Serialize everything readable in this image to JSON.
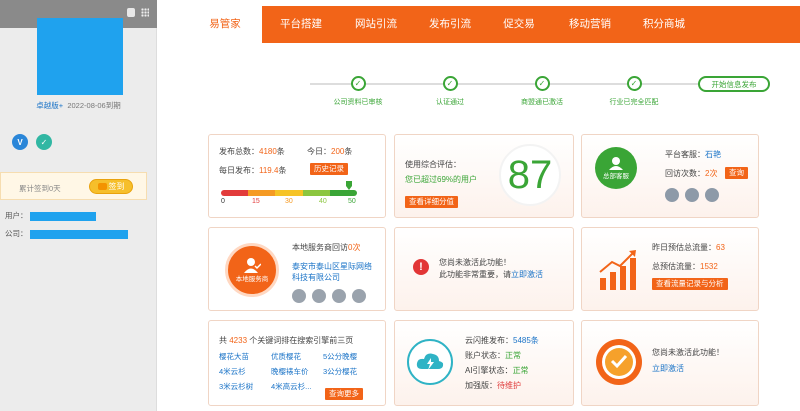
{
  "sidebar": {
    "edition": "卓越版+",
    "expire": "2022-08-06到期",
    "sign_label": "累计签到0天",
    "sign_button": "签到",
    "user_label": "用户：",
    "company_label": "公司："
  },
  "nav": {
    "tabs": [
      "易管家",
      "平台搭建",
      "网站引流",
      "发布引流",
      "促交易",
      "移动营销",
      "积分商城"
    ],
    "active": 0
  },
  "steps": {
    "items": [
      "公司资料已审核",
      "认证通过",
      "商盟通已激活",
      "行业已完全匹配"
    ],
    "start_button": "开始信息发布"
  },
  "publish": {
    "total_label": "发布总数：",
    "total_value": "4180",
    "total_unit": "条",
    "today_label": "今日：",
    "today_value": "200",
    "today_unit": "条",
    "daily_label": "每日发布：",
    "daily_value": "119.4",
    "daily_unit": "条",
    "history_button": "历史记录",
    "scale": [
      "0",
      "15",
      "30",
      "40",
      "50"
    ],
    "level": 0.94,
    "colors": [
      "#e23b3b",
      "#f59a23",
      "#f6c325",
      "#8cc63f",
      "#3aa536"
    ]
  },
  "evaluation": {
    "label": "使用综合评估：",
    "beat_prefix": "您已超过",
    "beat_value": "69%",
    "beat_suffix": "的用户",
    "detail_button": "查看详细分值",
    "score": "87"
  },
  "service": {
    "avatar_label": "总部客服",
    "agent_label": "平台客服：",
    "agent_name": "石艳",
    "visits_label": "回访次数：",
    "visits_value": "2次",
    "query_button": "查询"
  },
  "local": {
    "avatar_label": "本地服务商",
    "visit_prefix": "本地服务商回访",
    "visit_value": "0次",
    "company_line1": "泰安市泰山区星际网络",
    "company_line2": "科技有限公司"
  },
  "inactive1": {
    "line1": "您尚未激活此功能！",
    "line2_prefix": "此功能非常重要，请",
    "line2_link": "立即激活"
  },
  "traffic": {
    "yesterday_label": "昨日预估总流量：",
    "yesterday_value": "63",
    "total_label": "总预估流量：",
    "total_value": "1532",
    "button": "查看流量记录与分析"
  },
  "keywords": {
    "prefix": "共",
    "count": "4233",
    "suffix": "个关键词排在搜索引擎前三页",
    "items": [
      "樱花大苗",
      "优质樱花",
      "5公分晚樱",
      "4米云杉",
      "晚樱裱车价",
      "3公分樱花",
      "3米云杉树",
      "4米高云杉..."
    ],
    "more_button": "查询更多"
  },
  "cloud": {
    "push_label": "云闪推发布：",
    "push_value": "5485条",
    "account_label": "账户状态：",
    "account_value": "正常",
    "ai_label": "AI引擎状态：",
    "ai_value": "正常",
    "boost_label": "加强版：",
    "boost_value": "待维护"
  },
  "inactive2": {
    "line1": "您尚未激活此功能！",
    "link": "立即激活"
  }
}
